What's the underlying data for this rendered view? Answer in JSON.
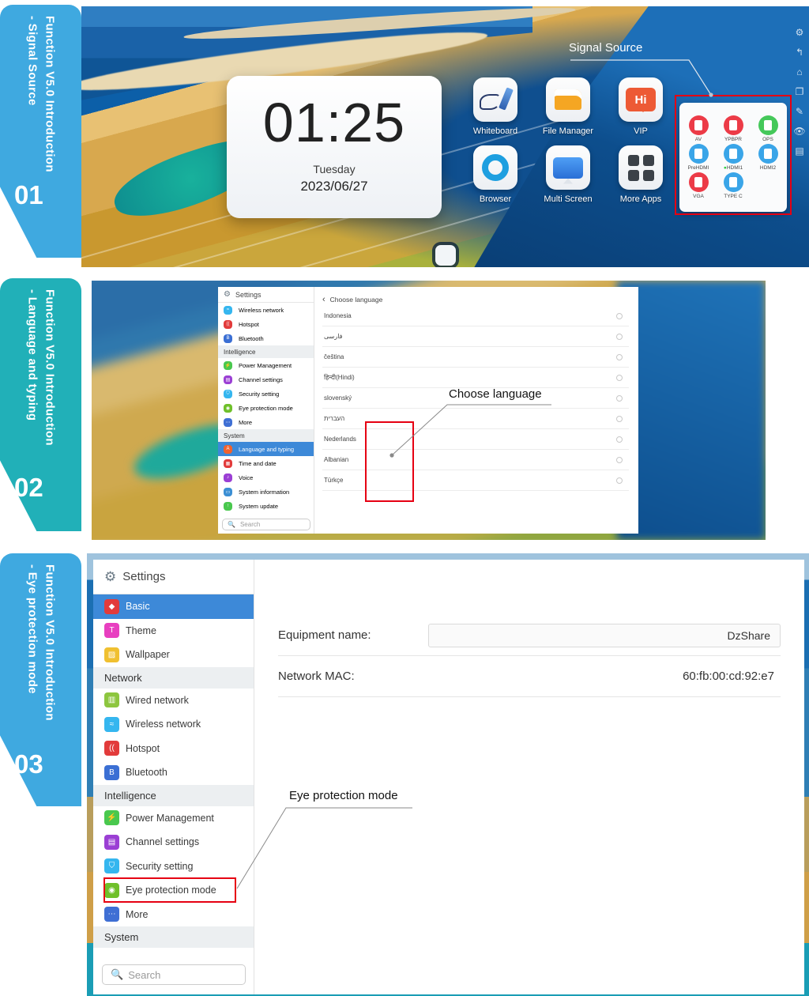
{
  "tabs": [
    {
      "number": "01",
      "title": "Function V5.0 Introduction\n- Signal Source",
      "color": "#3fa9e0"
    },
    {
      "number": "02",
      "title": "Function V5.0 Introduction\n- Language and typing",
      "color": "#21b0b8"
    },
    {
      "number": "03",
      "title": "Function V5.0 Introduction\n- Eye protection mode",
      "color": "#3fa9e0"
    }
  ],
  "panel1": {
    "annotation": "Signal Source",
    "clock": {
      "time": "01:25",
      "weekday": "Tuesday",
      "date": "2023/06/27"
    },
    "apps": [
      {
        "label": "Whiteboard",
        "icon": "whiteboard-pen-icon"
      },
      {
        "label": "File Manager",
        "icon": "folder-icon"
      },
      {
        "label": "VIP",
        "icon": "hi-bubble-icon"
      },
      {
        "label": "Browser",
        "icon": "browser-ring-icon"
      },
      {
        "label": "Multi Screen",
        "icon": "multi-screen-icon"
      },
      {
        "label": "More Apps",
        "icon": "grid-apps-icon"
      }
    ],
    "sources": [
      {
        "label": "AV",
        "color": "#ec3b47",
        "active": false
      },
      {
        "label": "YPBPR",
        "color": "#ec3b47",
        "active": false
      },
      {
        "label": "OPS",
        "color": "#45c85a",
        "active": false
      },
      {
        "label": "PreHDMI",
        "color": "#3aa5e8",
        "active": false
      },
      {
        "label": "HDMI1",
        "color": "#3aa5e8",
        "active": true
      },
      {
        "label": "HDMI2",
        "color": "#3aa5e8",
        "active": false
      },
      {
        "label": "VGA",
        "color": "#ec3b47",
        "active": false
      },
      {
        "label": "TYPE C",
        "color": "#3aa5e8",
        "active": false
      }
    ],
    "sidebar_icons": [
      "settings-gear-icon",
      "back-arrow-icon",
      "home-icon",
      "window-icon",
      "annotate-pen-icon",
      "eye-icon",
      "source-list-icon"
    ]
  },
  "panel2": {
    "annotation": "Choose language",
    "settings_title": "Settings",
    "search_placeholder": "Search",
    "back_label": "Choose language",
    "sidebar": [
      {
        "label": "Wireless network",
        "type": "item",
        "icon": "wifi-icon",
        "color": "c-wifi"
      },
      {
        "label": "Hotspot",
        "type": "item",
        "icon": "hotspot-icon",
        "color": "c-hot"
      },
      {
        "label": "Bluetooth",
        "type": "item",
        "icon": "bluetooth-icon",
        "color": "c-bt"
      },
      {
        "label": "Intelligence",
        "type": "group"
      },
      {
        "label": "Power Management",
        "type": "item",
        "icon": "power-icon",
        "color": "c-pow"
      },
      {
        "label": "Channel settings",
        "type": "item",
        "icon": "channel-icon",
        "color": "c-chan"
      },
      {
        "label": "Security setting",
        "type": "item",
        "icon": "shield-icon",
        "color": "c-sec"
      },
      {
        "label": "Eye protection mode",
        "type": "item",
        "icon": "eye-icon",
        "color": "c-eye"
      },
      {
        "label": "More",
        "type": "item",
        "icon": "more-dots-icon",
        "color": "c-more"
      },
      {
        "label": "System",
        "type": "group"
      },
      {
        "label": "Language and typing",
        "type": "item",
        "icon": "language-icon",
        "color": "c-lang",
        "selected": true
      },
      {
        "label": "Time and date",
        "type": "item",
        "icon": "calendar-icon",
        "color": "c-time"
      },
      {
        "label": "Voice",
        "type": "item",
        "icon": "voice-icon",
        "color": "c-voice"
      },
      {
        "label": "System information",
        "type": "item",
        "icon": "info-screen-icon",
        "color": "c-sys"
      },
      {
        "label": "System update",
        "type": "item",
        "icon": "update-icon",
        "color": "c-upd"
      }
    ],
    "languages": [
      "Indonesia",
      "فارسی",
      "čeština",
      "हिन्दी(Hindi)",
      "slovenský",
      "העברית",
      "Nederlands",
      "Albanian",
      "Türkçe"
    ],
    "highlighted_languages": [
      "העברית",
      "Nederlands",
      "Albanian",
      "Türkçe"
    ]
  },
  "panel3": {
    "annotation": "Eye protection mode",
    "settings_title": "Settings",
    "search_placeholder": "Search",
    "sidebar": [
      {
        "label": "Basic",
        "type": "item",
        "icon": "layers-icon",
        "color": "c-basic",
        "selected": true
      },
      {
        "label": "Theme",
        "type": "item",
        "icon": "shirt-icon",
        "color": "c-theme"
      },
      {
        "label": "Wallpaper",
        "type": "item",
        "icon": "picture-icon",
        "color": "c-wall"
      },
      {
        "label": "Network",
        "type": "group"
      },
      {
        "label": "Wired network",
        "type": "item",
        "icon": "ethernet-icon",
        "color": "c-wired"
      },
      {
        "label": "Wireless network",
        "type": "item",
        "icon": "wifi-icon",
        "color": "c-wifi"
      },
      {
        "label": "Hotspot",
        "type": "item",
        "icon": "hotspot-icon",
        "color": "c-hot"
      },
      {
        "label": "Bluetooth",
        "type": "item",
        "icon": "bluetooth-icon",
        "color": "c-bt"
      },
      {
        "label": "Intelligence",
        "type": "group"
      },
      {
        "label": "Power Management",
        "type": "item",
        "icon": "power-icon",
        "color": "c-pow"
      },
      {
        "label": "Channel settings",
        "type": "item",
        "icon": "channel-icon",
        "color": "c-chan"
      },
      {
        "label": "Security setting",
        "type": "item",
        "icon": "shield-icon",
        "color": "c-sec"
      },
      {
        "label": "Eye protection mode",
        "type": "item",
        "icon": "eye-icon",
        "color": "c-eye",
        "highlighted": true
      },
      {
        "label": "More",
        "type": "item",
        "icon": "more-dots-icon",
        "color": "c-more"
      },
      {
        "label": "System",
        "type": "group"
      }
    ],
    "fields": [
      {
        "key": "Equipment name:",
        "value": "DzShare",
        "type": "input"
      },
      {
        "key": "Network MAC:",
        "value": "60:fb:00:cd:92:e7",
        "type": "text"
      }
    ]
  }
}
